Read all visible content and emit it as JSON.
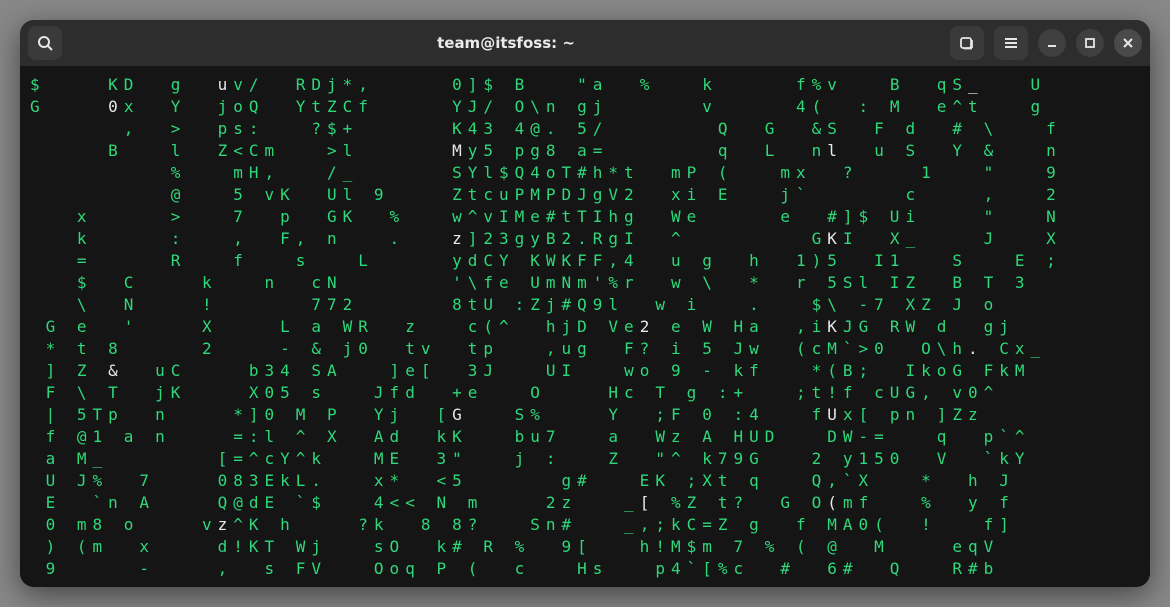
{
  "window": {
    "title": "team@itsfoss: ~"
  },
  "icons": {
    "search": "search-icon",
    "newtab": "new-tab-icon",
    "menu": "hamburger-icon",
    "minimize": "minimize-icon",
    "maximize": "maximize-icon",
    "close": "close-icon"
  },
  "terminal": {
    "lines": [
      "$    KD  g  uv/  RDj*,     0]$ B   \"a  %   k     f%v   B  qS_   U",
      "G    0x  Y  joQ  YtZCf     YJ/ O\\n gj      v     4(  : M  e^t   g",
      "      ,  >  ps:   ?$+      K43 4@. 5/       Q  G  &S  F d  # \\   f",
      "     B   l  Z<Cm   >l      My5 pg8 a=       q  L  nl  u S  Y &   n",
      "         %   mH,   /_      SYl$Q4oT#h*t  mP (   mx  ?    1   \"   9",
      "         @   5 vK  Ul 9    ZtcuPMPDJgV2  xi E   j`      c    ,   2",
      "   x     >   7  p  GK  %   w^vIMe#tTIhg  We     e  #]$ Ui    \"   N",
      "   k     :   ,  F, n   .   z]23gyB2.RgI  ^        GKI  X_    J   X",
      "   =     R   f   s   L     ydCY KWKFF,4  u g  h  1)5  I1   S   E ;",
      "   $  C    k   n  cN       '\\fe UmNm'%r  w \\  *  r 5Sl IZ  B T 3",
      "   \\  N    !      772      8tU :Zj#Q9l  w i   .   $\\ -7 XZ J o",
      " G e  '    X    L a WR  z   c(^  hjD Ve2 e W Ha  ,iKJG RW d  gj",
      " * t 8     2    - & j0  tv  tp   ,ug  F? i 5 Jw  (cM`>0  O\\h. Cx_",
      " ] Z &  uC    b34 SA   ]e[  3J   UI   wo 9 - kf   *(B;  IkoG FkM",
      " F \\ T  jK    X05 s   Jfd  +e   O    Hc T g :+   ;t!f cUG, v0^",
      " | 5Tp  n    *]0 M P  Yj  [G   S%    Y  ;F 0 :4   fUx[ pn ]Zz",
      " f @1 a n    =:l ^ X  Ad  kK   bu7   a  Wz A HUD   DW-=   q  p`^",
      " a M_       [=^cY^k   ME  3\"   j :   Z  \"^ k79G   2 y150  V  `kY",
      " U J%  7    083EkL.   x*  <5      g#   EK ;Xt q   Q,`X   *  h J",
      " E  `n A    Q@dE `$   4<< N m    2z   _[ %Z t?  G O(mf   %  y f",
      " 0 m8 o    vz^K h    ?k  8 8?   Sn#   _,;kC=Z g  f MA0(  !   f]",
      " ) (m  x    d!KT Wj   sO  k# R %  9[   h!M$m 7 % ( @  M    eqV",
      " 9     -    ,  s FV   Ooq P (  c   Hs   p4`[%c  #  6#  Q   R#b"
    ],
    "highlight_cols": [
      5,
      12,
      27,
      39,
      51,
      60,
      78,
      88
    ]
  }
}
